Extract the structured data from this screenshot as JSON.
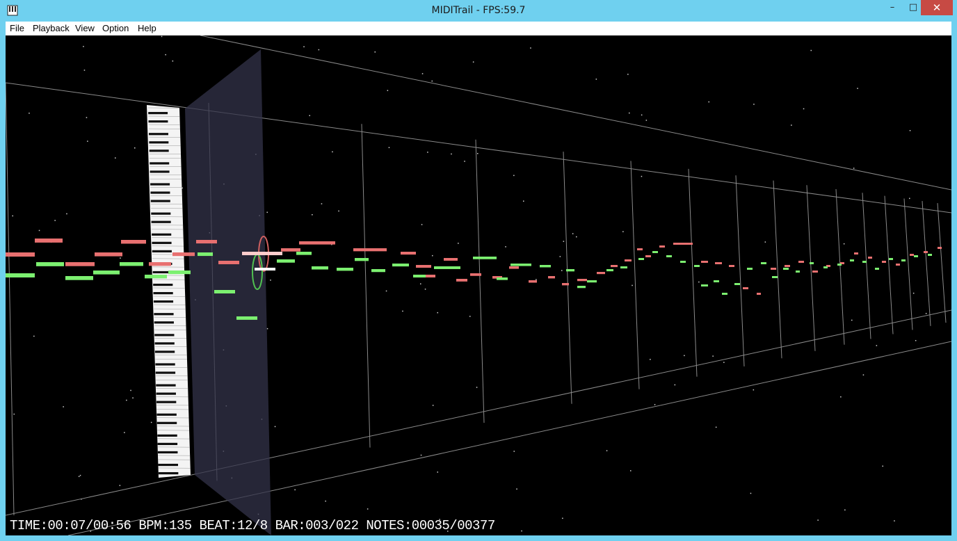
{
  "window": {
    "title": "MIDITrail - FPS:59.7",
    "icon": "midi-trail-app-icon",
    "minimize": "–",
    "maximize": "□",
    "close": "✕"
  },
  "menu": {
    "file": "File",
    "playback": "Playback",
    "view": "View",
    "option": "Option",
    "help": "Help"
  },
  "status": {
    "text": "TIME:00:07/00:56 BPM:135 BEAT:12/8 BAR:003/022 NOTES:00035/00377"
  },
  "colors": {
    "background": "#000000",
    "note_track_a": "#e87070",
    "note_track_b": "#7cf070",
    "grid_line": "#8a8a8a",
    "titlebar": "#6fd0ef",
    "close_button": "#c74a44"
  }
}
